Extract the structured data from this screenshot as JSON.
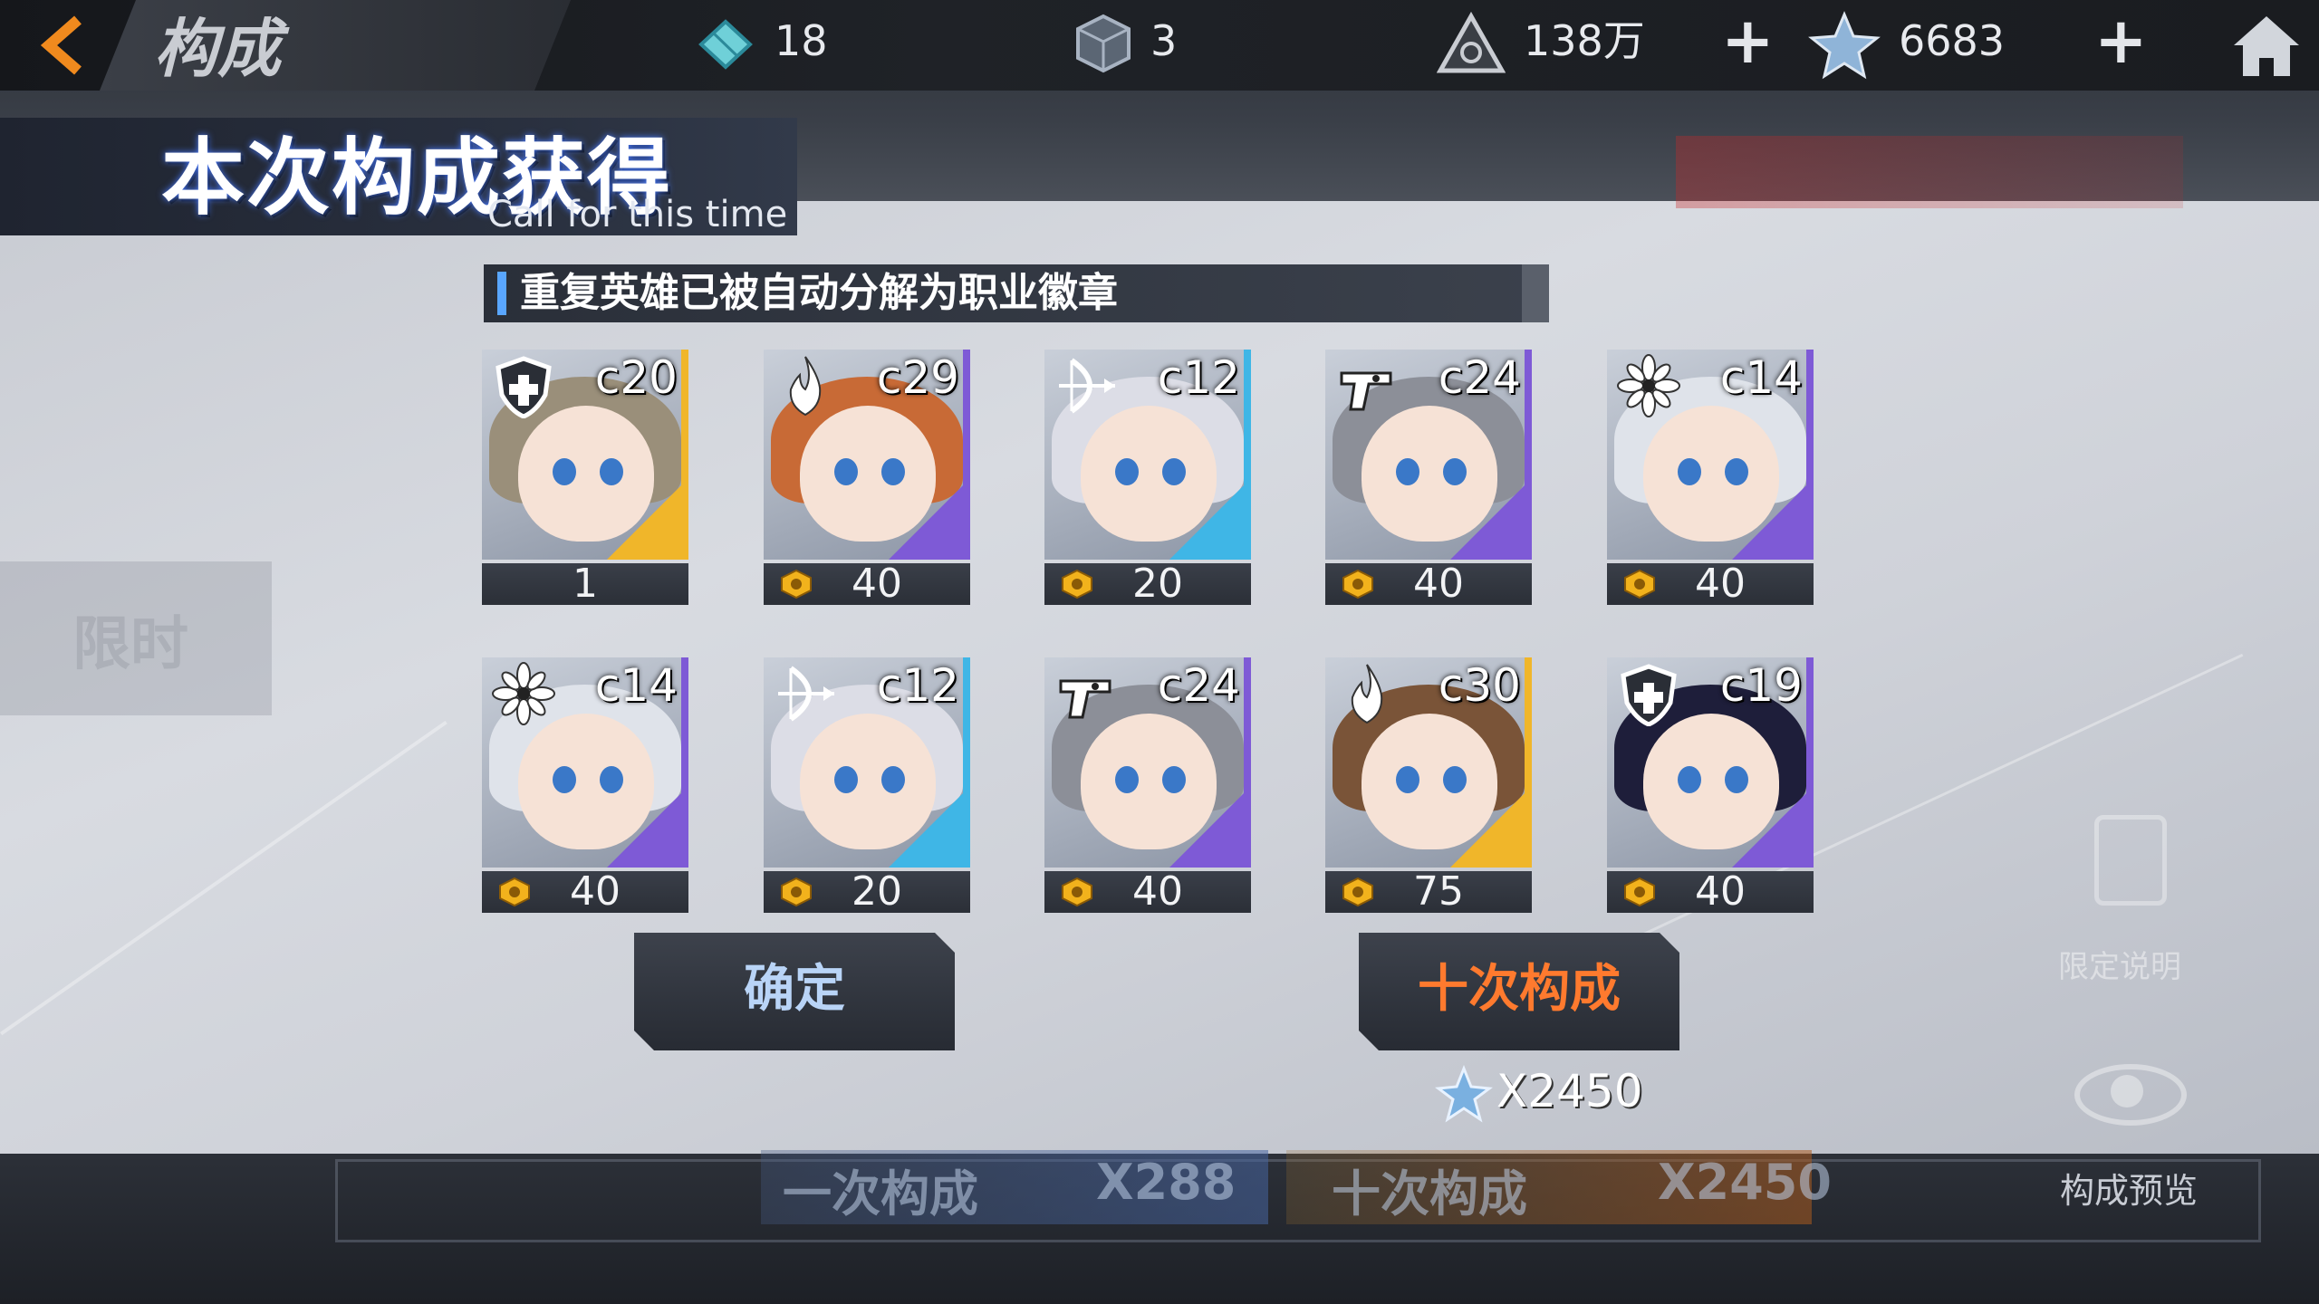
{
  "topbar": {
    "back_label": "<",
    "screen_title": "构成",
    "resources": [
      {
        "name": "crystal-cards",
        "value": "18"
      },
      {
        "name": "cube",
        "value": "3"
      },
      {
        "name": "coins",
        "value": "138万"
      },
      {
        "name": "star-crystal",
        "value": "6683"
      }
    ],
    "plus_label": "+"
  },
  "header": {
    "title": "本次构成获得",
    "subtitle": "Call for this time"
  },
  "notice": "重复英雄已被自动分解为职业徽章",
  "cards": [
    {
      "code": "c20",
      "class_icon": "shield-icon",
      "rarity": "gold",
      "value": "1"
    },
    {
      "code": "c29",
      "class_icon": "flame-icon",
      "rarity": "purple",
      "value": "40"
    },
    {
      "code": "c12",
      "class_icon": "bow-icon",
      "rarity": "blue",
      "value": "20"
    },
    {
      "code": "c24",
      "class_icon": "gun-icon",
      "rarity": "purple",
      "value": "40"
    },
    {
      "code": "c14",
      "class_icon": "flower-icon",
      "rarity": "purple",
      "value": "40"
    },
    {
      "code": "c14",
      "class_icon": "flower-icon",
      "rarity": "purple",
      "value": "40"
    },
    {
      "code": "c12",
      "class_icon": "bow-icon",
      "rarity": "blue",
      "value": "20"
    },
    {
      "code": "c24",
      "class_icon": "gun-icon",
      "rarity": "purple",
      "value": "40"
    },
    {
      "code": "c30",
      "class_icon": "flame-icon",
      "rarity": "gold",
      "value": "75"
    },
    {
      "code": "c19",
      "class_icon": "shield-icon",
      "rarity": "purple",
      "value": "40"
    }
  ],
  "buttons": {
    "confirm": "确定",
    "ten_pull": "十次构成",
    "ten_pull_cost": "X2450"
  },
  "bottom": {
    "single_label": "一次构成",
    "single_cost": "X288",
    "ten_label": "十次构成",
    "ten_cost": "X2450",
    "preview": "构成预览",
    "limited_desc": "限定说明",
    "limited": "限时"
  },
  "colors": {
    "gold": "#f0b62a",
    "purple": "#7e5ad6",
    "blue": "#3fb6e6",
    "accent_orange": "#ff7a2e",
    "accent_blue": "#59a6ff"
  }
}
